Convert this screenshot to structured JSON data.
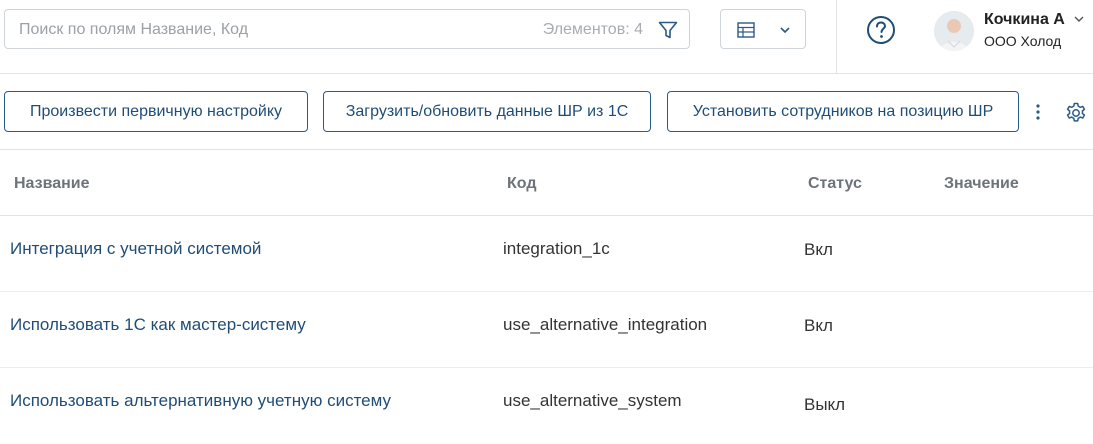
{
  "search": {
    "placeholder": "Поиск по полям Название, Код",
    "value": "",
    "count_label": "Элементов: 4",
    "filter_icon": "filter-icon"
  },
  "view_switcher": {
    "icon": "table-icon",
    "dropdown_icon": "chevron-down-icon"
  },
  "help": {
    "icon": "question-circle-icon"
  },
  "user": {
    "name": "Кочкина А",
    "org": "ООО Холод",
    "avatar": "avatar"
  },
  "toolbar": {
    "buttons": [
      {
        "label": "Произвести первичную настройку"
      },
      {
        "label": "Загрузить/обновить данные ШР из 1С"
      },
      {
        "label": "Установить сотрудников на позицию ШР"
      }
    ],
    "more_icon": "kebab-menu-icon",
    "settings_icon": "gear-icon"
  },
  "table": {
    "headers": {
      "name": "Название",
      "code": "Код",
      "status": "Статус",
      "value": "Значение"
    },
    "rows": [
      {
        "name": "Интеграция с учетной системой",
        "code": "integration_1c",
        "status": "Вкл",
        "value": ""
      },
      {
        "name": "Использовать 1С как мастер-систему",
        "code": "use_alternative_integration",
        "status": "Вкл",
        "value": ""
      },
      {
        "name": "Использовать альтернативную учетную систему",
        "code": "use_alternative_system",
        "status": "Выкл",
        "value": ""
      }
    ]
  },
  "colors": {
    "accent": "#1f4d78",
    "border": "#cfd4d9",
    "header_text": "#6d737a"
  }
}
